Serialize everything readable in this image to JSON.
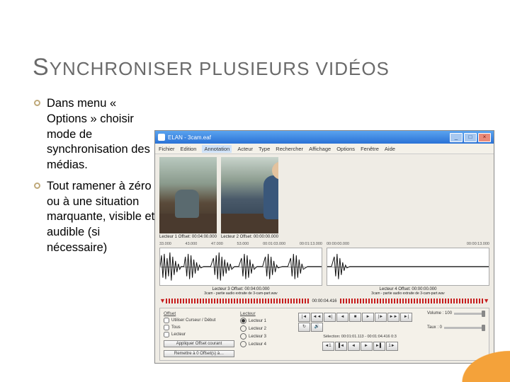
{
  "title_parts": {
    "s1": "S",
    "rest1": "ynchroniser plusieurs vidéos"
  },
  "title_full": "Synchroniser plusieurs vidéos",
  "bullets": [
    "Dans menu « Options » choisir mode de synchronisation des médias.",
    "Tout ramener à zéro ou à une situation marquante, visible et audible (si nécessaire)"
  ],
  "app": {
    "window_title": "ELAN - 3cam.eaf",
    "menubar": [
      "Fichier",
      "Edition",
      "Annotation",
      "Acteur",
      "Type",
      "Rechercher",
      "Affichage",
      "Options",
      "Fenêtre",
      "Aide"
    ],
    "active_menu_index": 2,
    "captions": {
      "video_left": "Lecteur 1 Offset: 00:04:00.000",
      "video_right": "Lecteur 2 Offset: 00:00:00.000"
    },
    "axis_left": [
      "33.000",
      "43.000",
      "47.000",
      "53.000",
      "00:01:03.000",
      "00:01:13.000"
    ],
    "axis_right": [
      "00:00:00.000",
      "00:00:13.000"
    ],
    "wave_caption_left": "Lecteur 3 Offset: 00:04:00.000",
    "wave_caption_left_sub": "3cam - partie audio extraite de 3-cam-part.wav",
    "wave_caption_right": "Lecteur 4 Offset: 00:00:00.000",
    "wave_caption_right_sub": "3cam - partie audio extraite de 3-cam-part.wav",
    "ruler_time": "00:00:04.416",
    "panel": {
      "offset_hdr": "Offset",
      "offset_opts": [
        "Utiliser Curseur / Début",
        "Tous",
        "Lecteur"
      ],
      "offset_btn1": "Appliquer Offset courant",
      "offset_btn2": "Remettre à 0 Offset(s) à…",
      "player_hdr": "Lecteur",
      "players": [
        "Lecteur 1",
        "Lecteur 2",
        "Lecteur 3",
        "Lecteur 4"
      ],
      "transport_icons": [
        "|◄",
        "◄◄",
        "◄|",
        "◄",
        "■",
        "►",
        "|►",
        "►►",
        "►|",
        "↻",
        "🔊"
      ],
      "transport_icons2": [
        "◄1",
        "▐◄",
        "◄",
        "►",
        "►▌",
        "1►"
      ],
      "selection_line": "Sélection: 00:01:01.113 - 00:01:04.416  0:3",
      "volume_hdr": "Volume : 100",
      "rate_hdr": "Taux :  0"
    }
  }
}
